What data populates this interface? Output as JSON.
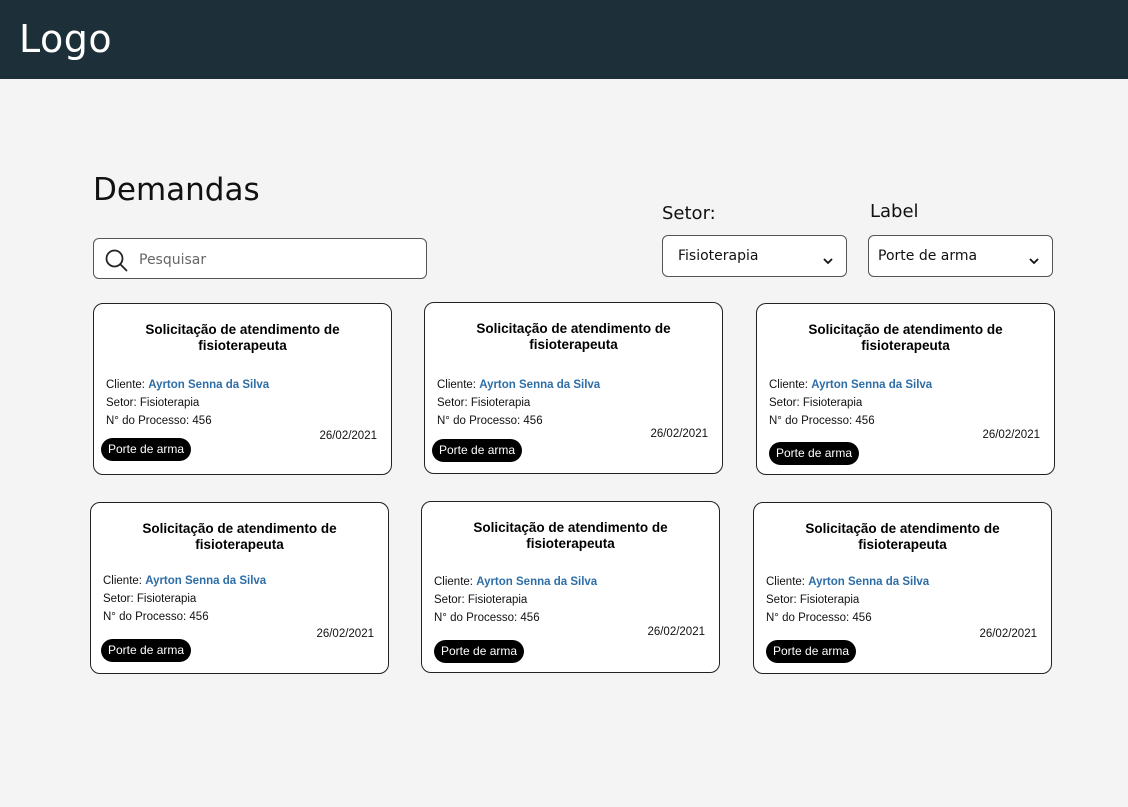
{
  "header": {
    "logo": "Logo"
  },
  "page": {
    "title": "Demandas"
  },
  "search": {
    "placeholder": "Pesquisar"
  },
  "filters": {
    "setor": {
      "label": "Setor:",
      "value": "Fisioterapia"
    },
    "label": {
      "label": "Label",
      "value": "Porte de arma"
    }
  },
  "cards": [
    {
      "title": "Solicitação de atendimento de fisioterapeuta",
      "client_prefix": "Cliente: ",
      "client": "Ayrton Senna da Silva",
      "setor": "Setor: Fisioterapia",
      "processo": "N° do Processo: 456",
      "date": "26/02/2021",
      "badge": "Porte de arma"
    },
    {
      "title": "Solicitação de atendimento de fisioterapeuta",
      "client_prefix": "Cliente: ",
      "client": "Ayrton Senna da Silva",
      "setor": "Setor: Fisioterapia",
      "processo": "N° do Processo: 456",
      "date": "26/02/2021",
      "badge": "Porte de arma"
    },
    {
      "title": "Solicitação de atendimento de fisioterapeuta",
      "client_prefix": "Cliente: ",
      "client": "Ayrton Senna da Silva",
      "setor": "Setor: Fisioterapia",
      "processo": "N° do Processo: 456",
      "date": "26/02/2021",
      "badge": "Porte de arma"
    },
    {
      "title": "Solicitação de atendimento de fisioterapeuta",
      "client_prefix": "Cliente: ",
      "client": "Ayrton Senna da Silva",
      "setor": "Setor: Fisioterapia",
      "processo": "N° do Processo: 456",
      "date": "26/02/2021",
      "badge": "Porte de arma"
    },
    {
      "title": "Solicitação de atendimento de fisioterapeuta",
      "client_prefix": "Cliente: ",
      "client": "Ayrton Senna da Silva",
      "setor": "Setor: Fisioterapia",
      "processo": "N° do Processo: 456",
      "date": "26/02/2021",
      "badge": "Porte de arma"
    },
    {
      "title": "Solicitação de atendimento de fisioterapeuta",
      "client_prefix": "Cliente: ",
      "client": "Ayrton Senna da Silva",
      "setor": "Setor: Fisioterapia",
      "processo": "N° do Processo: 456",
      "date": "26/02/2021",
      "badge": "Porte de arma"
    }
  ],
  "icons": {
    "search": "search-icon",
    "dropdown": "chevron-down-icon"
  },
  "colors": {
    "header_bg": "#1d2f38",
    "page_bg": "#f4f4f4",
    "client_link": "#2e6ea7",
    "badge_bg": "#000000"
  }
}
